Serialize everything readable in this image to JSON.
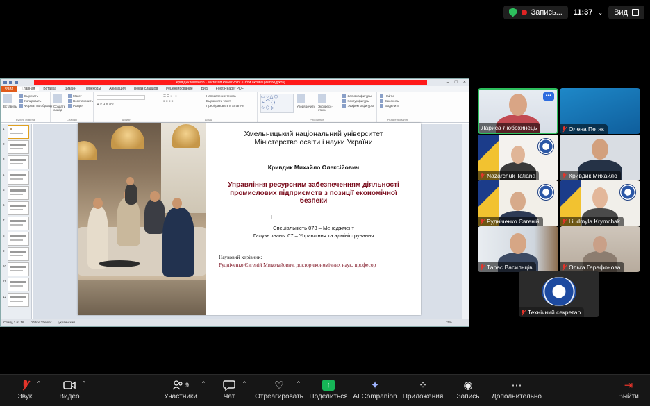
{
  "topbar": {
    "recording_label": "Запись...",
    "time": "11:37",
    "view_label": "Вид"
  },
  "powerpoint": {
    "title": "Кривдик Михайло - Microsoft PowerPoint (Сбой активации продукта)",
    "tabs": [
      "Файл",
      "Главная",
      "Вставка",
      "Дизайн",
      "Переходы",
      "Анимация",
      "Показ слайдов",
      "Рецензирование",
      "Вид",
      "Foxit Reader PDF"
    ],
    "ribbon": {
      "paste": "Вставить",
      "clipboard": [
        "Вырезать",
        "Копировать",
        "Формат по образцу"
      ],
      "clipboard_group": "Буфер обмена",
      "new_slide": "Создать слайд",
      "slides": [
        "Макет",
        "Восстановить",
        "Раздел"
      ],
      "slides_group": "Слайды",
      "font_group": "Шрифт",
      "paragraph_group": "Абзац",
      "paragraph": [
        "Направление текста",
        "Выровнять текст",
        "Преобразовать в SmartArt"
      ],
      "arrange": "Упорядочить",
      "quick_styles": "Экспресс-стили",
      "drawing": [
        "Заливка фигуры",
        "Контур фигуры",
        "Эффекты фигуры"
      ],
      "drawing_group": "Рисование",
      "editing": [
        "Найти",
        "Заменить",
        "Выделить"
      ],
      "editing_group": "Редактирование"
    },
    "status": {
      "slide": "Слайд 1 из 16",
      "theme": "\"Office Theme\"",
      "lang": "украинский",
      "zoom": "75%"
    }
  },
  "slide": {
    "university": "Хмельницький національний університет",
    "ministry": "Міністерство освіти і науки України",
    "author": "Кривдик Михайло Олексійович",
    "theme_line1": "Управління ресурсним забезпеченням діяльності",
    "theme_line2": "промислових підприємств з позиції економічної",
    "theme_line3": "безпеки",
    "specialty": "Спеціальність 073 – Менеджмент",
    "field": "Галузь знань: 07 – Управління та адміністрування",
    "supervisor_label": "Науковий керівник:",
    "supervisor": "Рудніченко Євгеній Миколайович, доктор економічних наук, професор"
  },
  "participants": [
    {
      "name": "Лариса Любохинець"
    },
    {
      "name": "Олена Петяк"
    },
    {
      "name": "Nazarchuk Tatiana"
    },
    {
      "name": "Кривдик Михайло"
    },
    {
      "name": "Рудніченко Євгеній"
    },
    {
      "name": "Liudmyla Krymchak"
    },
    {
      "name": "Тарас Васильців"
    },
    {
      "name": "Ольга Гарафонова"
    },
    {
      "name": "Технічний секретар"
    }
  ],
  "more_button": "•••",
  "toolbar": {
    "audio": "Звук",
    "video": "Видео",
    "participants": "Участники",
    "participants_count": "9",
    "chat": "Чат",
    "react": "Отреагировать",
    "share": "Поделиться",
    "ai": "AI Companion",
    "apps": "Приложения",
    "record": "Запись",
    "more": "Дополнительно",
    "leave": "Выйти"
  },
  "colors": {
    "active_speaker": "#2dbf5d",
    "share_green": "#16b557",
    "mute_red": "#e5342a",
    "theme_red": "#7a0c1c"
  }
}
